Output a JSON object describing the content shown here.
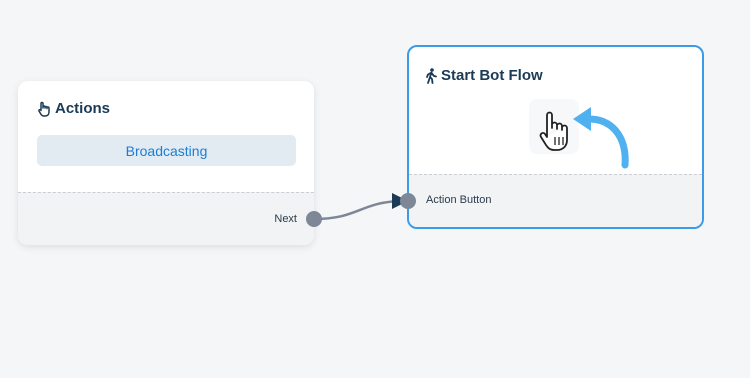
{
  "nodes": {
    "actions": {
      "title": "Actions",
      "icon": "pointing-hand-icon",
      "button_label": "Broadcasting",
      "output_label": "Next"
    },
    "start_bot_flow": {
      "title": "Start Bot Flow",
      "icon": "walking-person-icon",
      "illustration": "hand-cursor-with-arrow",
      "input_label": "Action Button"
    }
  },
  "colors": {
    "canvas_bg": "#f4f6f8",
    "title_text": "#1b3a55",
    "accent_blue": "#1a7fd4",
    "selected_border": "#3b9be8",
    "handle": "#7d8796",
    "edge": "#7d8796",
    "arrowhead": "#1b3a55",
    "illustration_arrow": "#4fb1f0"
  }
}
